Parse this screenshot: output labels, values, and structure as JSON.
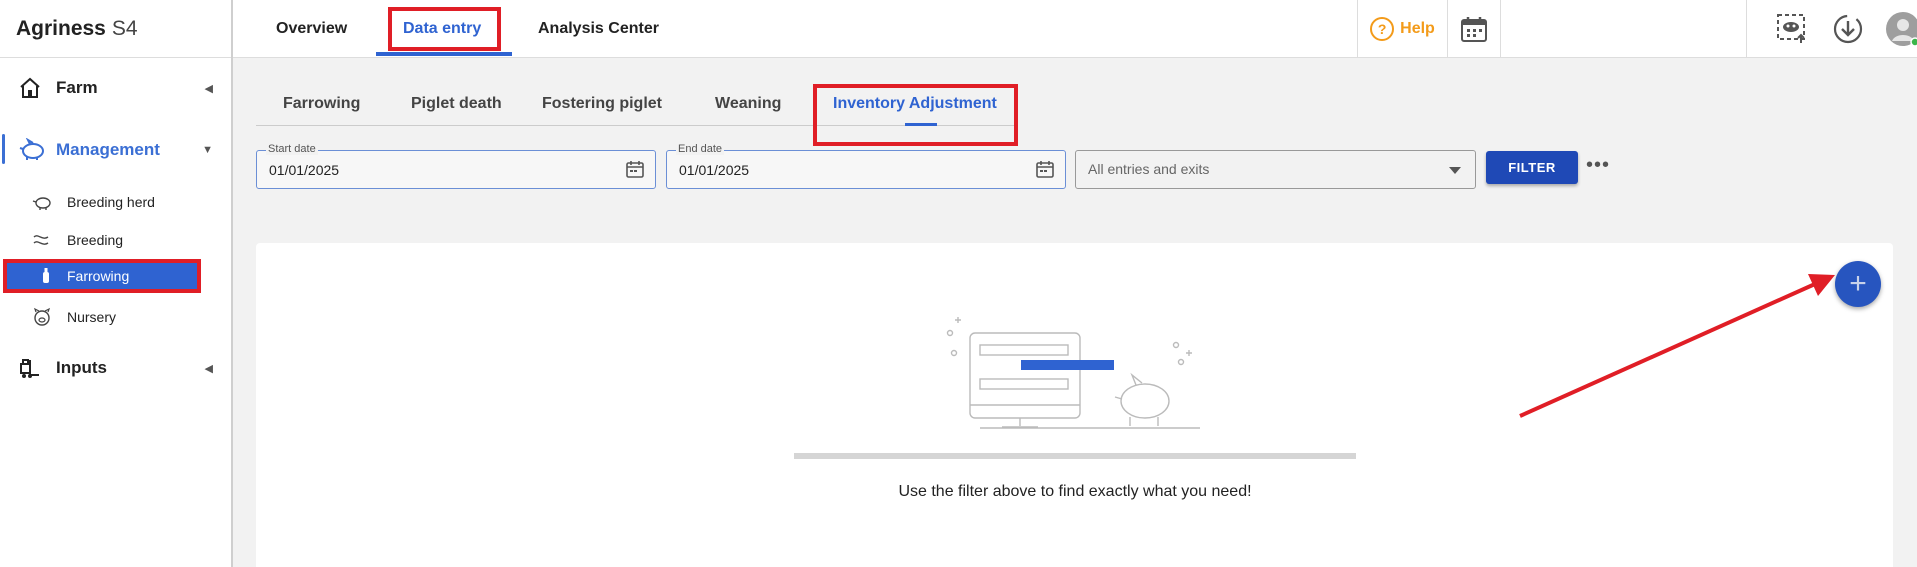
{
  "sidebar": {
    "brand": {
      "name": "Agriness",
      "version": "S4"
    },
    "groups": [
      {
        "label": "Farm",
        "icon": "home-icon"
      },
      {
        "label": "Management",
        "icon": "pig-icon"
      },
      {
        "label": "Inputs",
        "icon": "forklift-icon"
      }
    ],
    "management_items": [
      {
        "label": "Breeding herd",
        "icon": "pig-outline-icon"
      },
      {
        "label": "Breeding",
        "icon": "breeding-icon"
      },
      {
        "label": "Farrowing",
        "icon": "bottle-icon"
      },
      {
        "label": "Nursery",
        "icon": "piglet-face-icon"
      }
    ]
  },
  "topbar": {
    "tabs": [
      {
        "label": "Overview"
      },
      {
        "label": "Data entry"
      },
      {
        "label": "Analysis Center"
      }
    ],
    "help_label": "Help"
  },
  "subtabs": [
    {
      "label": "Farrowing"
    },
    {
      "label": "Piglet death"
    },
    {
      "label": "Fostering piglet"
    },
    {
      "label": "Weaning"
    },
    {
      "label": "Inventory Adjustment"
    }
  ],
  "filter": {
    "start_date": {
      "label": "Start date",
      "value": "01/01/2025"
    },
    "end_date": {
      "label": "End date",
      "value": "01/01/2025"
    },
    "type_select": {
      "value": "All entries and exits"
    },
    "button_label": "FILTER",
    "more_label": "•••"
  },
  "main": {
    "add_symbol": "+",
    "empty_message": "Use the filter above to find exactly what you need!"
  },
  "colors": {
    "accent": "#2f63d1",
    "highlight_box": "#e01e26",
    "help": "#f39b1a",
    "filter_button": "#1f49b6"
  }
}
